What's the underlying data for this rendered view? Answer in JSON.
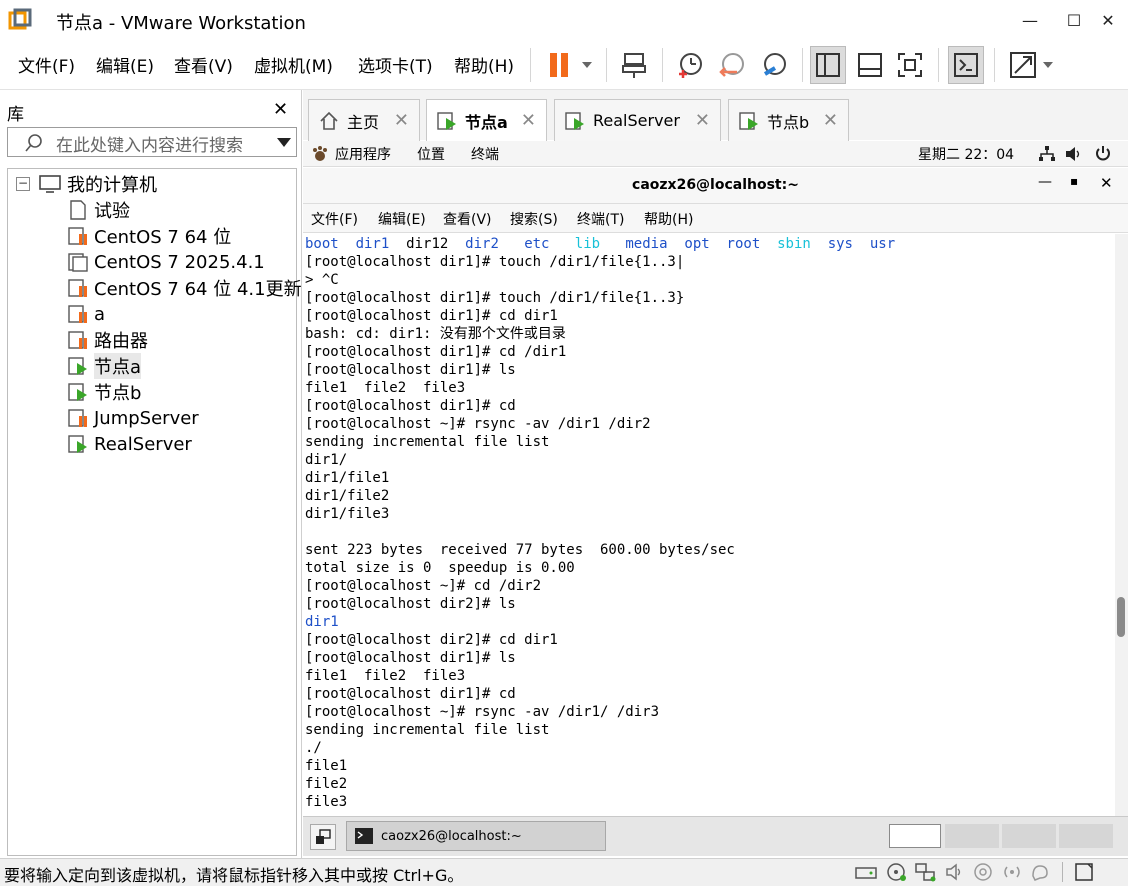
{
  "window": {
    "title": "节点a - VMware Workstation",
    "minimize": "—",
    "maximize": "☐",
    "close": "✕"
  },
  "menu": [
    "文件(F)",
    "编辑(E)",
    "查看(V)",
    "虚拟机(M)",
    "选项卡(T)",
    "帮助(H)"
  ],
  "library": {
    "title": "库",
    "search_placeholder": "在此处键入内容进行搜索",
    "root": "我的计算机",
    "items": [
      {
        "label": "试验",
        "state": "file"
      },
      {
        "label": "CentOS 7 64 位",
        "state": "paused"
      },
      {
        "label": "CentOS 7 2025.4.1",
        "state": "off"
      },
      {
        "label": "CentOS 7 64 位 4.1更新",
        "state": "paused"
      },
      {
        "label": "a",
        "state": "paused"
      },
      {
        "label": "路由器",
        "state": "paused"
      },
      {
        "label": "节点a",
        "state": "running",
        "selected": true
      },
      {
        "label": "节点b",
        "state": "running"
      },
      {
        "label": "JumpServer",
        "state": "paused"
      },
      {
        "label": "RealServer",
        "state": "running"
      }
    ]
  },
  "tabs": [
    {
      "label": "主页",
      "active": false
    },
    {
      "label": "节点a",
      "active": true
    },
    {
      "label": "RealServer",
      "active": false
    },
    {
      "label": "节点b",
      "active": false
    }
  ],
  "gnome": {
    "apps": "应用程序",
    "places": "位置",
    "terminal": "终端",
    "clock": "星期二 22：04"
  },
  "terminal": {
    "title": "caozx26@localhost:~",
    "menu": [
      "文件(F)",
      "编辑(E)",
      "查看(V)",
      "搜索(S)",
      "终端(T)",
      "帮助(H)"
    ],
    "ls_root": [
      {
        "t": "boot",
        "c": "blue"
      },
      {
        "t": "dir1",
        "c": "blue"
      },
      {
        "t": "dir12",
        "c": ""
      },
      {
        "t": "dir2",
        "c": "blue"
      },
      {
        "t": "etc",
        "c": "blue"
      },
      {
        "t": "lib",
        "c": "cyan"
      },
      {
        "t": "media",
        "c": "blue"
      },
      {
        "t": "opt",
        "c": "blue"
      },
      {
        "t": "root",
        "c": "blue"
      },
      {
        "t": "sbin",
        "c": "cyan"
      },
      {
        "t": "sys",
        "c": "blue"
      },
      {
        "t": "usr",
        "c": "blue"
      }
    ],
    "lines": [
      "[root@localhost dir1]# touch /dir1/file{1..3|",
      "> ^C",
      "[root@localhost dir1]# touch /dir1/file{1..3}",
      "[root@localhost dir1]# cd dir1",
      "bash: cd: dir1: 没有那个文件或目录",
      "[root@localhost dir1]# cd /dir1",
      "[root@localhost dir1]# ls",
      "file1  file2  file3",
      "[root@localhost dir1]# cd",
      "[root@localhost ~]# rsync -av /dir1 /dir2",
      "sending incremental file list",
      "dir1/",
      "dir1/file1",
      "dir1/file2",
      "dir1/file3",
      "",
      "sent 223 bytes  received 77 bytes  600.00 bytes/sec",
      "total size is 0  speedup is 0.00",
      "[root@localhost ~]# cd /dir2",
      "[root@localhost dir2]# ls",
      "",
      "[root@localhost dir2]# cd dir1",
      "[root@localhost dir1]# ls",
      "file1  file2  file3",
      "[root@localhost dir1]# cd",
      "[root@localhost ~]# rsync -av /dir1/ /dir3",
      "sending incremental file list",
      "./",
      "file1",
      "file2",
      "file3"
    ],
    "blue_line_20": "dir1"
  },
  "taskbar": {
    "task": "caozx26@localhost:~"
  },
  "status": {
    "text": "要将输入定向到该虚拟机，请将鼠标指针移入其中或按 Ctrl+G。"
  }
}
